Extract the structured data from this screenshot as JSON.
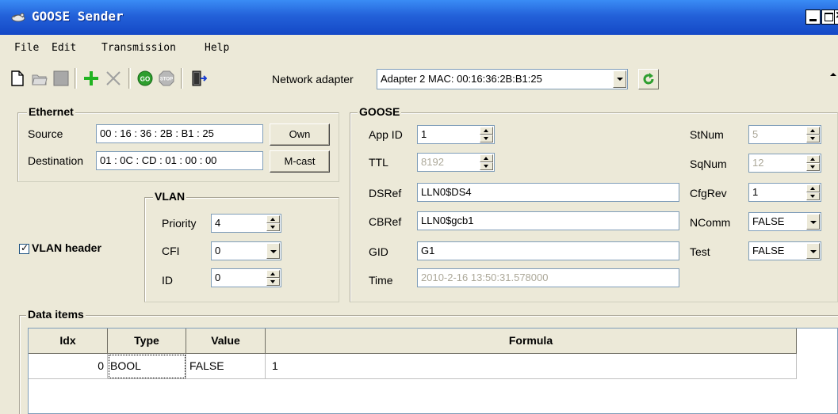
{
  "window": {
    "title": "GOOSE Sender"
  },
  "menu": {
    "items": [
      {
        "label": "File"
      },
      {
        "label": "Edit"
      },
      {
        "label": "Transmission"
      },
      {
        "label": "Help"
      }
    ]
  },
  "toolbar": {
    "adapter_label": "Network adapter",
    "adapter_value": "Adapter 2 MAC: 00:16:36:2B:B1:25",
    "go_label": "GO",
    "stop_label": "STOP"
  },
  "ethernet": {
    "title": "Ethernet",
    "source_label": "Source",
    "source_value": "00 : 16 : 36 : 2B : B1 : 25",
    "own_button": "Own",
    "destination_label": "Destination",
    "destination_value": "01 : 0C : CD : 01 : 00 : 00",
    "mcast_button": "M-cast"
  },
  "vlan": {
    "title": "VLAN",
    "header_checkbox_label": "VLAN header",
    "header_checked": true,
    "priority_label": "Priority",
    "priority_value": "4",
    "cfi_label": "CFI",
    "cfi_value": "0",
    "id_label": "ID",
    "id_value": "0"
  },
  "goose": {
    "title": "GOOSE",
    "appid_label": "App ID",
    "appid_value": "1",
    "ttl_label": "TTL",
    "ttl_value": "8192",
    "dsref_label": "DSRef",
    "dsref_value": "LLN0$DS4",
    "cbref_label": "CBRef",
    "cbref_value": "LLN0$gcb1",
    "gid_label": "GID",
    "gid_value": "G1",
    "time_label": "Time",
    "time_value": "2010-2-16 13:50:31.578000",
    "stnum_label": "StNum",
    "stnum_value": "5",
    "sqnum_label": "SqNum",
    "sqnum_value": "12",
    "cfgrev_label": "CfgRev",
    "cfgrev_value": "1",
    "ncomm_label": "NComm",
    "ncomm_value": "FALSE",
    "test_label": "Test",
    "test_value": "FALSE"
  },
  "data_items": {
    "title": "Data items",
    "columns": [
      "Idx",
      "Type",
      "Value",
      "Formula"
    ],
    "rows": [
      {
        "idx": "0",
        "type": "BOOL",
        "value": "FALSE",
        "formula": "1"
      }
    ]
  },
  "colors": {
    "titlebar": "#2361d9",
    "window_bg": "#ece9d8",
    "go_green": "#2e9e2e",
    "plus_green": "#21b321",
    "field_border": "#7f9db9"
  },
  "icons": [
    "goose-app-icon",
    "new-file-icon",
    "open-folder-icon",
    "save-icon",
    "add-icon",
    "delete-icon",
    "go-icon",
    "stop-icon",
    "exit-door-icon",
    "refresh-icon"
  ]
}
